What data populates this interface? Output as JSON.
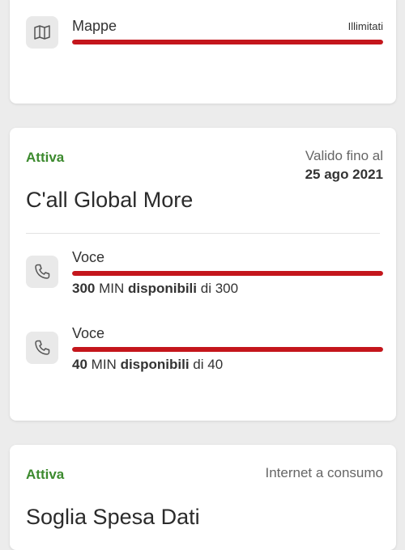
{
  "maps_item": {
    "label": "Mappe",
    "status": "Illimitati",
    "icon": "map-icon",
    "fill_fraction": 1.0
  },
  "plan": {
    "status": "Attiva",
    "valid_label": "Valido fino al",
    "valid_date": "25 ago 2021",
    "title": "C'all Global More",
    "items": [
      {
        "label": "Voce",
        "icon": "phone-icon",
        "amount": "300",
        "unit": "MIN",
        "available_word": "disponibili",
        "of_word": "di",
        "total": "300",
        "fill_fraction": 1.0
      },
      {
        "label": "Voce",
        "icon": "phone-icon",
        "amount": "40",
        "unit": "MIN",
        "available_word": "disponibili",
        "of_word": "di",
        "total": "40",
        "fill_fraction": 1.0
      }
    ]
  },
  "threshold": {
    "status": "Attiva",
    "note": "Internet a consumo",
    "title": "Soglia Spesa Dati"
  },
  "colors": {
    "accent_red": "#c4161c",
    "active_green": "#3c8a2e"
  }
}
